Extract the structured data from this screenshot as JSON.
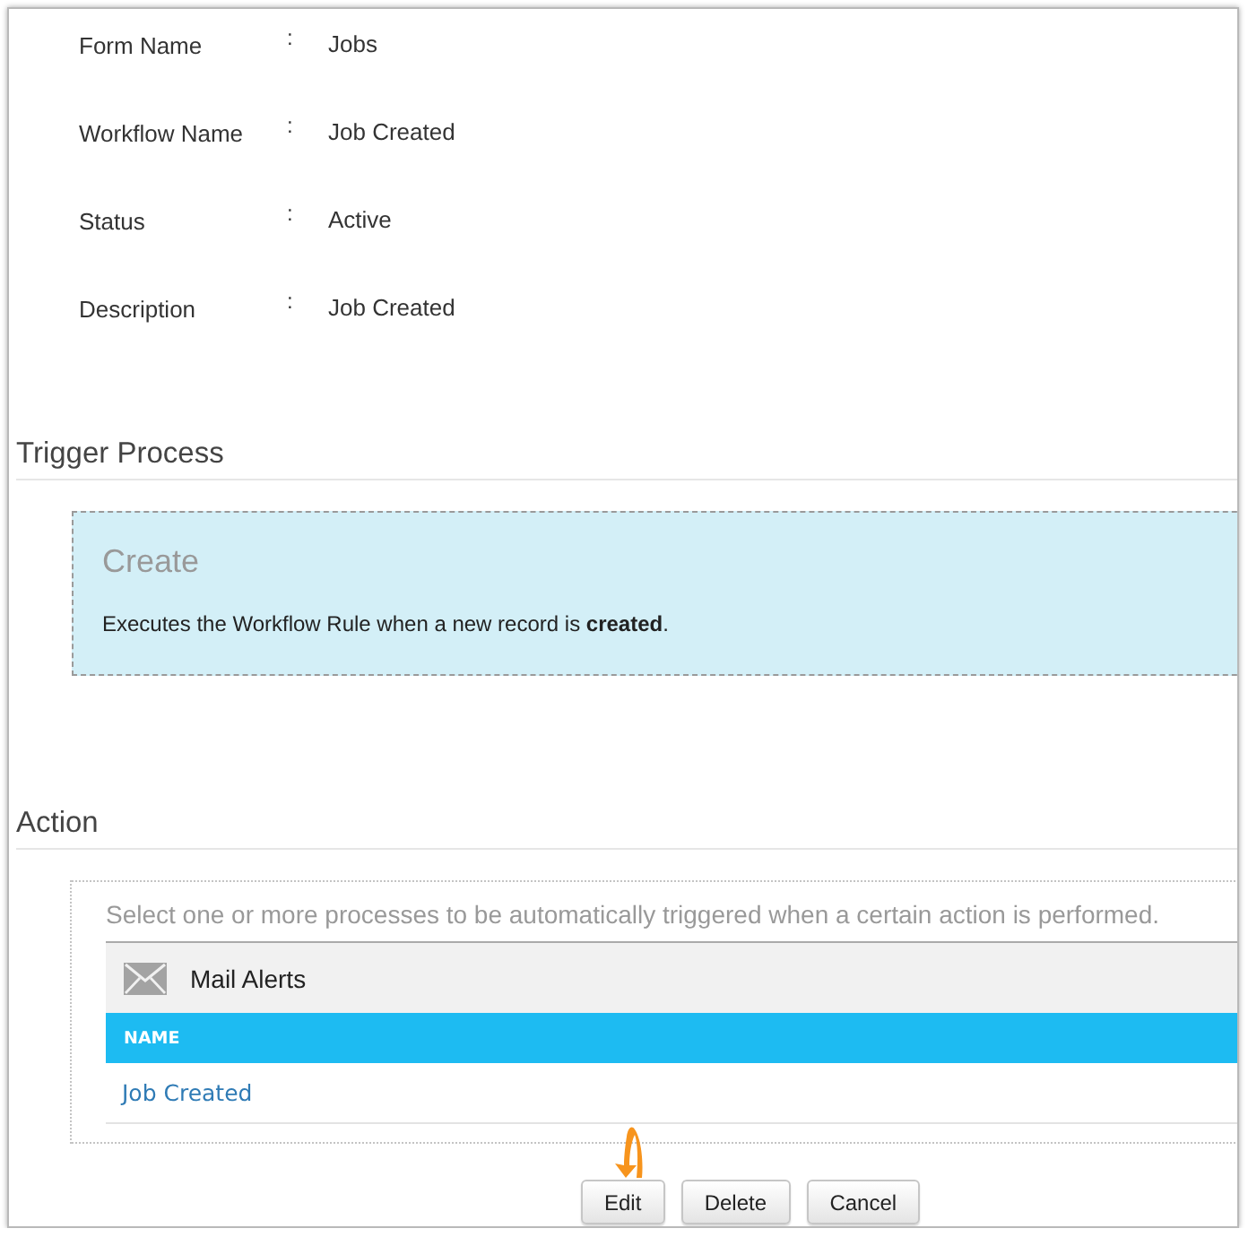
{
  "details": [
    {
      "label": "Form Name",
      "separator": ":",
      "value": "Jobs"
    },
    {
      "label": "Workflow Name",
      "separator": ":",
      "value": "Job Created"
    },
    {
      "label": "Status",
      "separator": ":",
      "value": "Active"
    },
    {
      "label": "Description",
      "separator": ":",
      "value": "Job Created"
    }
  ],
  "trigger": {
    "heading": "Trigger Process",
    "card": {
      "title": "Create",
      "description": "Executes the Workflow Rule when a new record is **created**."
    }
  },
  "action": {
    "heading": "Action",
    "hint": "Select one or more processes to be automatically triggered when a certain action is performed.",
    "groups": [
      {
        "title": "Mail Alerts",
        "columns": [
          "NAME"
        ],
        "rows": [
          {
            "name": "Job Created"
          }
        ]
      }
    ]
  },
  "buttons": [
    {
      "label": "Edit"
    },
    {
      "label": "Delete"
    },
    {
      "label": "Cancel"
    }
  ]
}
